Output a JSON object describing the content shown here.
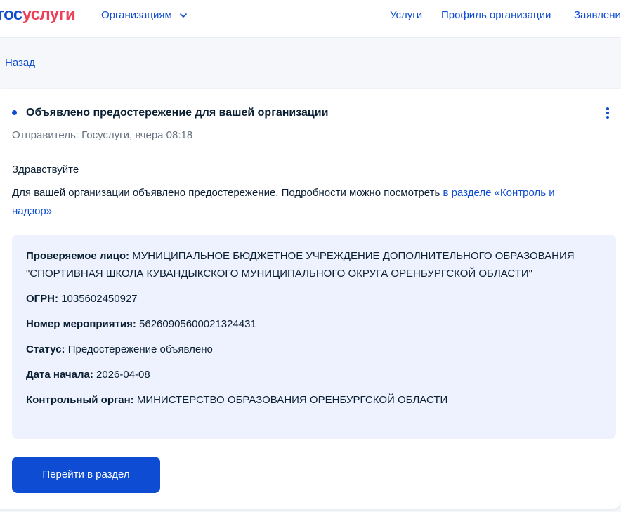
{
  "header": {
    "logo_part1": "гос",
    "logo_part2": "услуги",
    "org_menu_label": "Организациям",
    "nav": {
      "services": "Услуги",
      "org_profile": "Профиль организации",
      "applications": "Заявления"
    }
  },
  "back_label": "Назад",
  "notice": {
    "title": "Объявлено предостережение для вашей организации",
    "sender": "Отправитель: Госуслуги, вчера 08:18",
    "greeting": "Здравствуйте",
    "message_text": "Для вашей организации объявлено предостережение. Подробности можно посмотреть ",
    "message_link": "в разделе «Контроль и надзор»",
    "details": [
      {
        "label": "Проверяемое лицо:",
        "value": "МУНИЦИПАЛЬНОЕ БЮДЖЕТНОЕ УЧРЕЖДЕНИЕ ДОПОЛНИТЕЛЬНОГО ОБРАЗОВАНИЯ \"СПОРТИВНАЯ ШКОЛА КУВАНДЫКСКОГО МУНИЦИПАЛЬНОГО ОКРУГА ОРЕНБУРГСКОЙ ОБЛАСТИ\""
      },
      {
        "label": "ОГРН:",
        "value": "1035602450927"
      },
      {
        "label": "Номер мероприятия:",
        "value": "56260905600021324431"
      },
      {
        "label": "Статус:",
        "value": "Предостережение объявлено"
      },
      {
        "label": "Дата начала:",
        "value": "2026-04-08"
      },
      {
        "label": "Контрольный орган:",
        "value": "МИНИСТЕРСТВО ОБРАЗОВАНИЯ ОРЕНБУРГСКОЙ ОБЛАСТИ"
      }
    ],
    "button_label": "Перейти в раздел"
  },
  "colors": {
    "brand_blue": "#0d4cd3",
    "brand_red": "#ee3f58",
    "info_bg": "#edf2fe"
  }
}
